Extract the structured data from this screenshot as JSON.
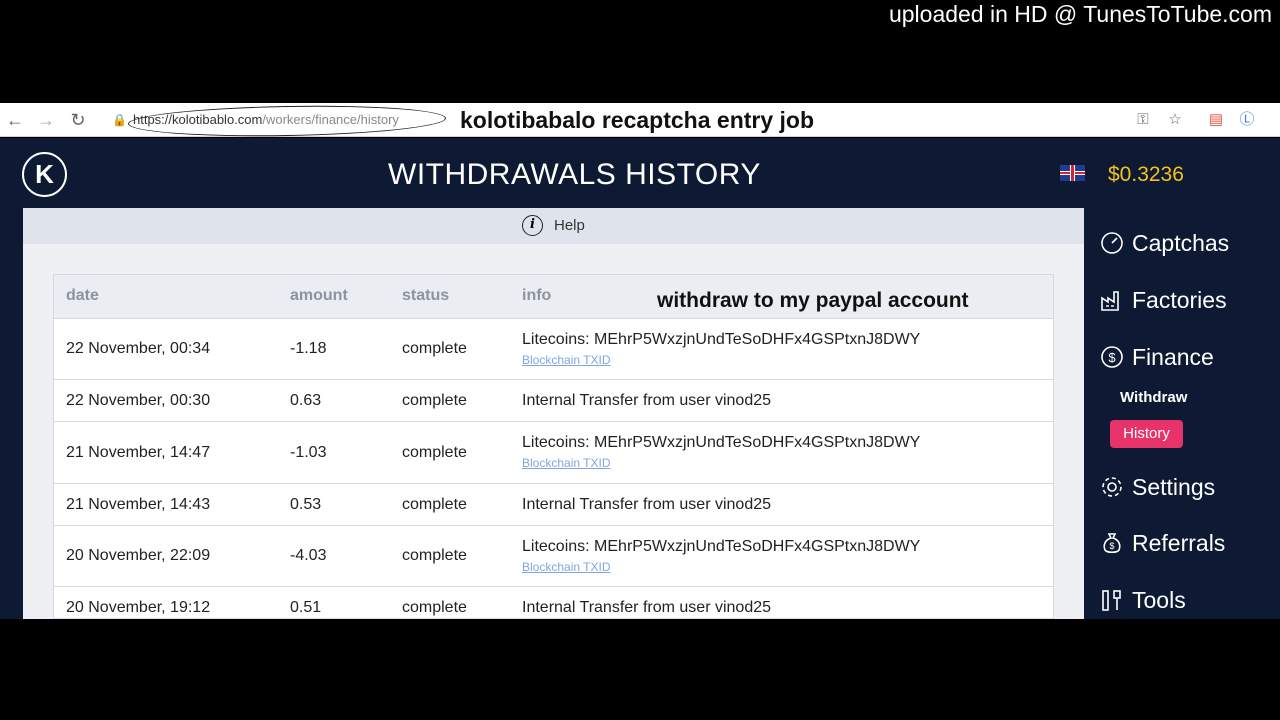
{
  "watermark": "uploaded in HD @ TunesToTube.com",
  "browser": {
    "url_host": "https://kolotibablo.com",
    "url_path": "/workers/finance/history",
    "overlay_title": "kolotibabalo recaptcha entry job"
  },
  "header": {
    "title": "WITHDRAWALS HISTORY",
    "balance": "$0.3236"
  },
  "help": {
    "label": "Help",
    "icon": "i"
  },
  "table": {
    "columns": [
      "date",
      "amount",
      "status",
      "info"
    ],
    "note": "withdraw to my paypal account",
    "rows": [
      {
        "date": "22 November, 00:34",
        "amount": "-1.18",
        "status": "complete",
        "info": "Litecoins: MEhrP5WxzjnUndTeSoDHFx4GSPtxnJ8DWY",
        "link": "Blockchain TXID"
      },
      {
        "date": "22 November, 00:30",
        "amount": "0.63",
        "status": "complete",
        "info": "Internal Transfer from user vinod25",
        "link": ""
      },
      {
        "date": "21 November, 14:47",
        "amount": "-1.03",
        "status": "complete",
        "info": "Litecoins: MEhrP5WxzjnUndTeSoDHFx4GSPtxnJ8DWY",
        "link": "Blockchain TXID"
      },
      {
        "date": "21 November, 14:43",
        "amount": "0.53",
        "status": "complete",
        "info": "Internal Transfer from user vinod25",
        "link": ""
      },
      {
        "date": "20 November, 22:09",
        "amount": "-4.03",
        "status": "complete",
        "info": "Litecoins: MEhrP5WxzjnUndTeSoDHFx4GSPtxnJ8DWY",
        "link": "Blockchain TXID"
      },
      {
        "date": "20 November, 19:12",
        "amount": "0.51",
        "status": "complete",
        "info": "Internal Transfer from user vinod25",
        "link": ""
      }
    ]
  },
  "sidebar": {
    "captchas": "Captchas",
    "factories": "Factories",
    "finance": "Finance",
    "withdraw": "Withdraw",
    "history": "History",
    "settings": "Settings",
    "referrals": "Referrals",
    "tools": "Tools"
  },
  "colors": {
    "app_bg": "#0e1a33",
    "balance": "#f4c21b",
    "active_item": "#e8336a",
    "link": "#7fa6e0"
  }
}
